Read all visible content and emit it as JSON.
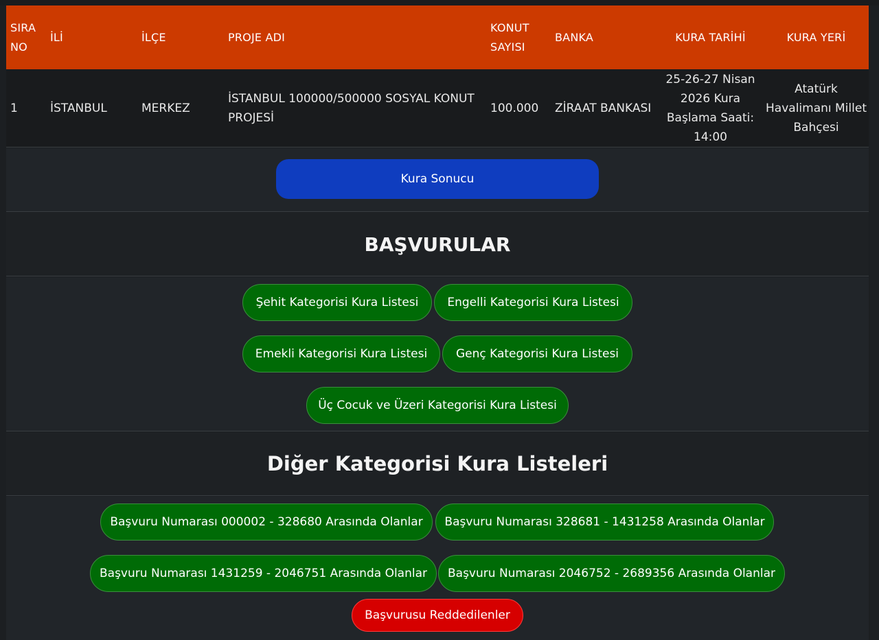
{
  "table": {
    "headers": {
      "sira_no": "SIRA NO",
      "ili": "İLİ",
      "ilce": "İLÇE",
      "proje_adi": "PROJE ADI",
      "konut_sayisi": "KONUT SAYISI",
      "banka": "BANKA",
      "kura_tarihi": "KURA TARİHİ",
      "kura_yeri": "KURA YERİ"
    },
    "rows": [
      {
        "sira_no": "1",
        "ili": "İSTANBUL",
        "ilce": "MERKEZ",
        "proje_adi": "İSTANBUL 100000/500000 SOSYAL KONUT PROJESİ",
        "konut_sayisi": "100.000",
        "banka": "ZİRAAT BANKASI",
        "kura_tarihi": "25-26-27 Nisan 2026 Kura Başlama Saati: 14:00",
        "kura_yeri": "Atatürk Havalimanı Millet Bahçesi"
      }
    ]
  },
  "result_button": "Kura Sonucu",
  "basvurular": {
    "title": "BAŞVURULAR",
    "buttons": [
      "Şehit Kategorisi Kura Listesi",
      "Engelli Kategorisi Kura Listesi",
      "Emekli Kategorisi Kura Listesi",
      "Genç Kategorisi Kura Listesi",
      "Üç Cocuk ve Üzeri Kategorisi Kura Listesi"
    ]
  },
  "diger": {
    "title": "Diğer Kategorisi Kura Listeleri",
    "buttons": [
      "Başvuru Numarası 000002 - 328680 Arasında Olanlar",
      "Başvuru Numarası 328681 - 1431258 Arasında Olanlar",
      "Başvuru Numarası 1431259 - 2046751 Arasında Olanlar",
      "Başvuru Numarası 2046752 - 2689356 Arasında Olanlar"
    ],
    "rejected_button": "Başvurusu Reddedilenler"
  },
  "colors": {
    "header_bg": "#cc3a00",
    "blue_button": "#0f3dbf",
    "green_button": "#006b06",
    "red_button": "#d60000"
  }
}
